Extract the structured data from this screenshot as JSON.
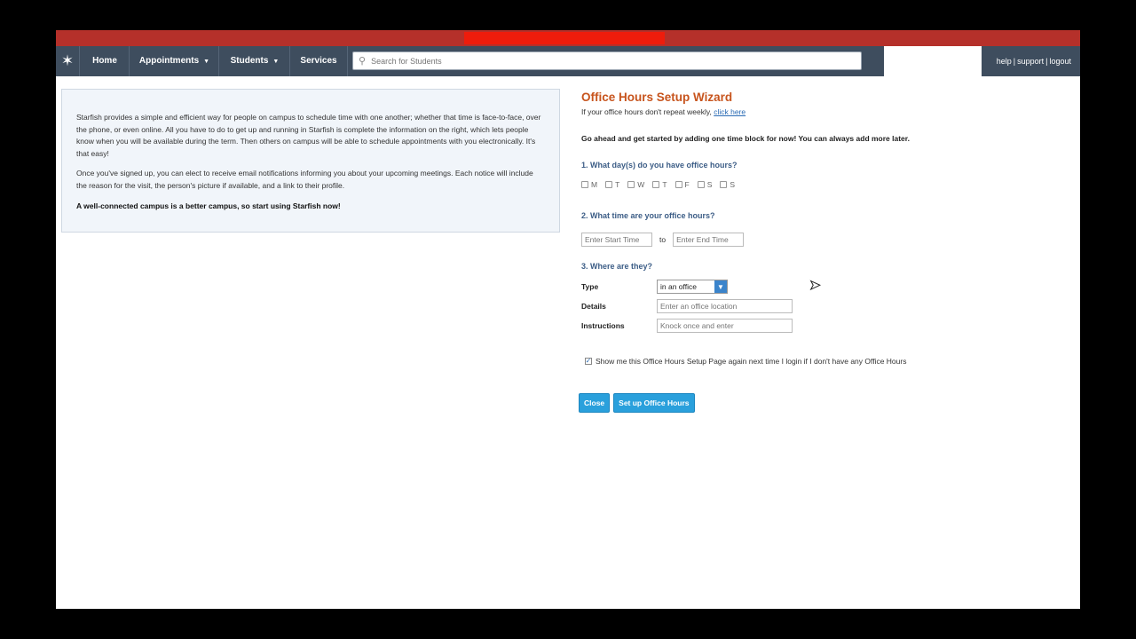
{
  "nav": {
    "logo_icon": "starfish-icon",
    "items": [
      {
        "label": "Home",
        "dropdown": false
      },
      {
        "label": "Appointments",
        "dropdown": true
      },
      {
        "label": "Students",
        "dropdown": true
      },
      {
        "label": "Services",
        "dropdown": false
      }
    ],
    "search_placeholder": "Search for Students",
    "links": [
      "help",
      "support",
      "logout"
    ]
  },
  "info": {
    "paragraph1": "Starfish provides a simple and efficient way for people on campus to schedule time with one another; whether that time is face-to-face, over the phone, or even online. All you have to do to get up and running in Starfish is complete the information on the right, which lets people know when you will be available during the term. Then others on campus will be able to schedule appointments with you electronically. It's that easy!",
    "paragraph2": "Once you've signed up, you can elect to receive email notifications informing you about your upcoming meetings. Each notice will include the reason for the visit, the person's picture if available, and a link to their profile.",
    "paragraph3": "A well-connected campus is a better campus, so start using Starfish now!"
  },
  "wizard": {
    "title": "Office Hours Setup Wizard",
    "subtitle": "If your office hours don't repeat weekly,",
    "subtitle_link": "click here",
    "intro": "Go ahead and get started by adding one time block for now! You can always add more later.",
    "q1": "1. What day(s) do you have office hours?",
    "days": [
      "M",
      "T",
      "W",
      "T",
      "F",
      "S",
      "S"
    ],
    "q2": "2. What time are your office hours?",
    "start_placeholder": "Enter Start Time",
    "to_label": "to",
    "end_placeholder": "Enter End Time",
    "q3": "3. Where are they?",
    "type_label": "Type",
    "type_value": "in an office",
    "details_label": "Details",
    "details_placeholder": "Enter an office location",
    "instructions_label": "Instructions",
    "instructions_placeholder": "Knock once and enter",
    "show_again_text": "Show me this Office Hours Setup Page again next time I login if I don't have any Office Hours",
    "show_again_checked": true,
    "close_button": "Close",
    "setup_button": "Set up Office Hours"
  },
  "colors": {
    "nav_bg": "#3e4d5e",
    "title_orange": "#c7541d",
    "question_blue": "#3c5d86",
    "button_blue": "#2aa0dc"
  }
}
